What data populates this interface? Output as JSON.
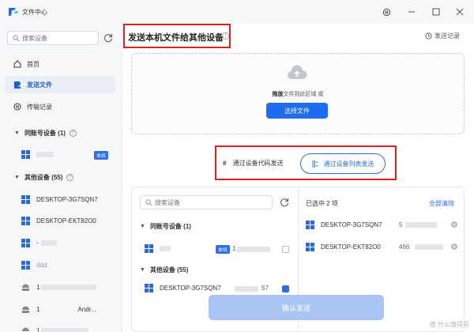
{
  "window": {
    "title": "文件中心"
  },
  "sidebar": {
    "search_placeholder": "搜索设备",
    "nav": [
      {
        "label": "首页"
      },
      {
        "label": "发送文件"
      },
      {
        "label": "传输记录"
      }
    ],
    "groups": [
      {
        "label": "同账号设备 (1)"
      },
      {
        "label": "其他设备 (55)"
      }
    ],
    "local_badge": "本机",
    "devices": [
      {
        "name": "DESKTOP-3G7SQN7"
      },
      {
        "name": "DESKTOP-EKT82O0"
      },
      {
        "name": "-"
      },
      {
        "name": "ddd"
      },
      {
        "name": "1"
      },
      {
        "name": "1　　　　　　Andr..."
      },
      {
        "name": "1"
      }
    ]
  },
  "main": {
    "title": "发送本机文件给其他设备",
    "send_record": "发送记录",
    "drop_hint_bold": "拖放",
    "drop_hint_rest": "文件到此区域 或",
    "choose_file": "选择文件",
    "code_send": "通过设备代码发送",
    "list_send": "通过设备列表发送",
    "panel": {
      "search_placeholder": "搜索设备",
      "group_same": "同账号设备 (1)",
      "group_other": "其他设备 (55)",
      "local_badge": "本机",
      "local_ip": "1",
      "other_first": "DESKTOP-3G7SQN7",
      "other_first_ip": "57",
      "selected_count": "已选中 2 项",
      "clear_all": "全部清除",
      "selected": [
        {
          "name": "DESKTOP-3G7SQN7",
          "ip": "5"
        },
        {
          "name": "DESKTOP-EKT82O0",
          "ip": "466"
        }
      ]
    },
    "confirm": "确认发送"
  },
  "watermark": "值 什么值得买",
  "colors": {
    "accent": "#1e6bf0",
    "highlight": "#e02020",
    "confirm_disabled": "#a9c5f4"
  }
}
